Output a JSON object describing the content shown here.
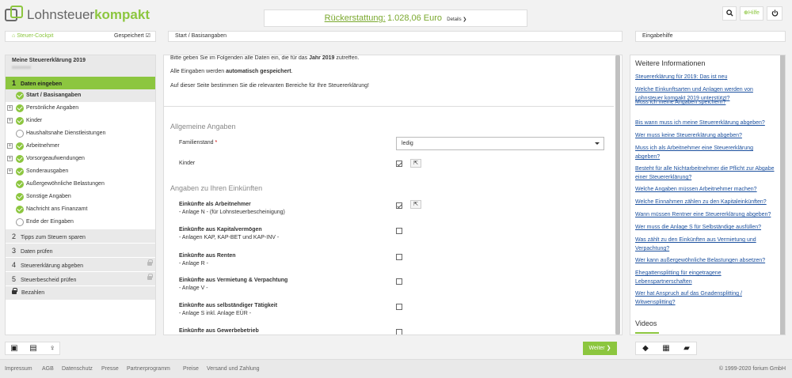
{
  "header": {
    "logo_part1": "Lohnsteuer",
    "logo_part2": "kompakt",
    "refund_label": "Rückerstattung:",
    "refund_value": "1.028,06 Euro",
    "details": "Details ❯",
    "search_icon": "search-icon",
    "help_label": "Hilfe",
    "power_icon": "power-icon"
  },
  "cockpit": {
    "title": "Steuer-Cockpit",
    "saved": "Gespeichert"
  },
  "breadcrumb": "Start / Basisangaben",
  "help_bar": "Eingabehilfe",
  "sidebar": {
    "declaration_title": "Meine Steuererklärung 2019",
    "declaration_sub": "xxxxxxxx",
    "active_step": {
      "num": "1",
      "label": "Daten eingeben"
    },
    "subitems": [
      {
        "label": "Start / Basisangaben",
        "status": "done",
        "expand": false,
        "active": true
      },
      {
        "label": "Persönliche Angaben",
        "status": "done",
        "expand": true
      },
      {
        "label": "Kinder",
        "status": "done",
        "expand": true
      },
      {
        "label": "Haushaltsnahe Dienstleistungen",
        "status": "open",
        "expand": false
      },
      {
        "label": "Arbeitnehmer",
        "status": "done",
        "expand": true
      },
      {
        "label": "Vorsorgeaufwendungen",
        "status": "done",
        "expand": true
      },
      {
        "label": "Sonderausgaben",
        "status": "done",
        "expand": true
      },
      {
        "label": "Außergewöhnliche Belastungen",
        "status": "done",
        "expand": false
      },
      {
        "label": "Sonstige Angaben",
        "status": "done",
        "expand": false
      },
      {
        "label": "Nachricht ans Finanzamt",
        "status": "done",
        "expand": false
      },
      {
        "label": "Ende der Eingaben",
        "status": "open",
        "expand": false
      }
    ],
    "steps": [
      {
        "num": "2",
        "label": "Tipps zum Steuern sparen",
        "locked": false
      },
      {
        "num": "3",
        "label": "Daten prüfen",
        "locked": false
      },
      {
        "num": "4",
        "label": "Steuererklärung abgeben",
        "locked": true
      },
      {
        "num": "5",
        "label": "Steuerbescheid prüfen",
        "locked": true
      }
    ],
    "pay": "Bezahlen"
  },
  "main": {
    "intro1_a": "Bitte geben Sie im Folgenden alle Daten ein, die für das ",
    "intro1_b": "Jahr 2019",
    "intro1_c": " zutreffen.",
    "intro2_a": "Alle Eingaben werden ",
    "intro2_b": "automatisch gespeichert",
    "intro2_c": ".",
    "intro3": "Auf dieser Seite bestimmen Sie die relevanten Bereiche für Ihre Steuererklärung!",
    "section1": "Allgemeine Angaben",
    "familienstand_label": "Familienstand",
    "familienstand_req": "*",
    "familienstand_value": "ledig",
    "kinder_label": "Kinder",
    "section2": "Angaben zu Ihren Einkünften",
    "income": [
      {
        "title": "Einkünfte als Arbeitnehmer",
        "sub": "- Anlage N - (für Lohnsteuerbescheinigung)",
        "checked": true
      },
      {
        "title": "Einkünfte aus Kapitalvermögen",
        "sub": "- Anlagen KAP, KAP-BET und KAP-INV -",
        "checked": false
      },
      {
        "title": "Einkünfte aus Renten",
        "sub": "- Anlage R -",
        "checked": false
      },
      {
        "title": "Einkünfte aus Vermietung & Verpachtung",
        "sub": "- Anlage V -",
        "checked": false
      },
      {
        "title": "Einkünfte aus selbständiger Tätigkeit",
        "sub": "- Anlage S inkl. Anlage EÜR -",
        "checked": false
      },
      {
        "title": "Einkünfte aus Gewerbebetrieb",
        "sub": "",
        "checked": false
      }
    ],
    "weiter": "Weiter ❯"
  },
  "help": {
    "title": "Weitere Informationen",
    "links": [
      "Steuererklärung für 2019: Das ist neu",
      "Welche Einkunftsarten und Anlagen werden von Lohnsteuer kompakt 2019 unterstützt?",
      "Muss ich meine Angaben speichern?",
      "Bis wann muss ich meine Steuererklärung abgeben?",
      "Wer muss keine Steuererklärung abgeben?",
      "Muss ich als Arbeitnehmer eine Steuererklärung abgeben?",
      "Besteht für alle Nichtarbeitnehmer die Pflicht zur Abgabe einer Steuererklärung?",
      "Welche Angaben müssen Arbeitnehmer machen?",
      "Welche Einnahmen zählen zu den Kapitaleinkünften?",
      "Wann müssen Rentner eine Steuererklärung abgeben?",
      "Wer muss die Anlage S für Selbständige ausfüllen?",
      "Was zählt zu den Einkünften aus Vermietung und Verpachtung?",
      "Wer kann außergewöhnliche Belastungen absetzen?",
      "Ehegattensplitting für eingetragene Lebenspartnerschaften",
      "Wer hat Anspruch auf das Gnadensplitting / Witwensplitting?"
    ],
    "videos": "Videos"
  },
  "footer": {
    "links": [
      "Impressum",
      "AGB",
      "Datenschutz",
      "Presse",
      "Partnerprogramm",
      "Preise",
      "Versand und Zahlung"
    ],
    "copyright": "© 1999-2020 forium GmbH"
  },
  "colors": {
    "accent": "#8cc63f",
    "link": "#1a4f9e"
  }
}
